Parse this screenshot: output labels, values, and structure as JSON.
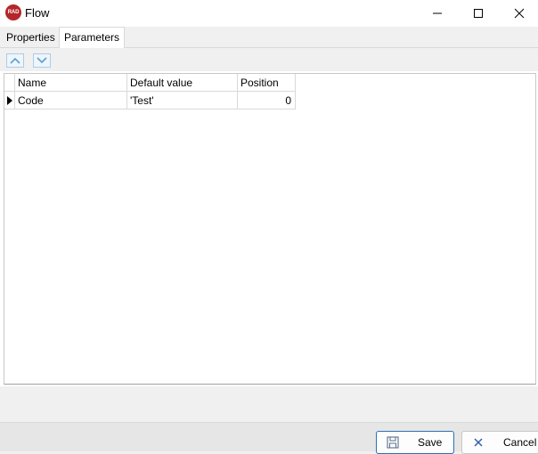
{
  "window": {
    "icon_text": "RAD",
    "title": "Flow",
    "controls": [
      "minimize-icon",
      "maximize-icon",
      "close-icon"
    ]
  },
  "tabs": [
    {
      "label": "Properties",
      "active": false
    },
    {
      "label": "Parameters",
      "active": true
    }
  ],
  "toolbar": {
    "icons": [
      "chevron-up-icon",
      "chevron-down-icon"
    ]
  },
  "grid": {
    "columns": [
      "Name",
      "Default value",
      "Position"
    ],
    "rows": [
      {
        "name": "Code",
        "default_value": "'Test'",
        "position": "0",
        "current": true
      }
    ]
  },
  "footer": {
    "save_label": "Save",
    "cancel_label": "Cancel",
    "save_icon": "floppy-disk-icon",
    "cancel_icon": "x-icon"
  },
  "colors": {
    "accent_border": "#2f6fb6",
    "app_icon": "#b4262a",
    "toolbar_button": "#5a9fd4"
  }
}
